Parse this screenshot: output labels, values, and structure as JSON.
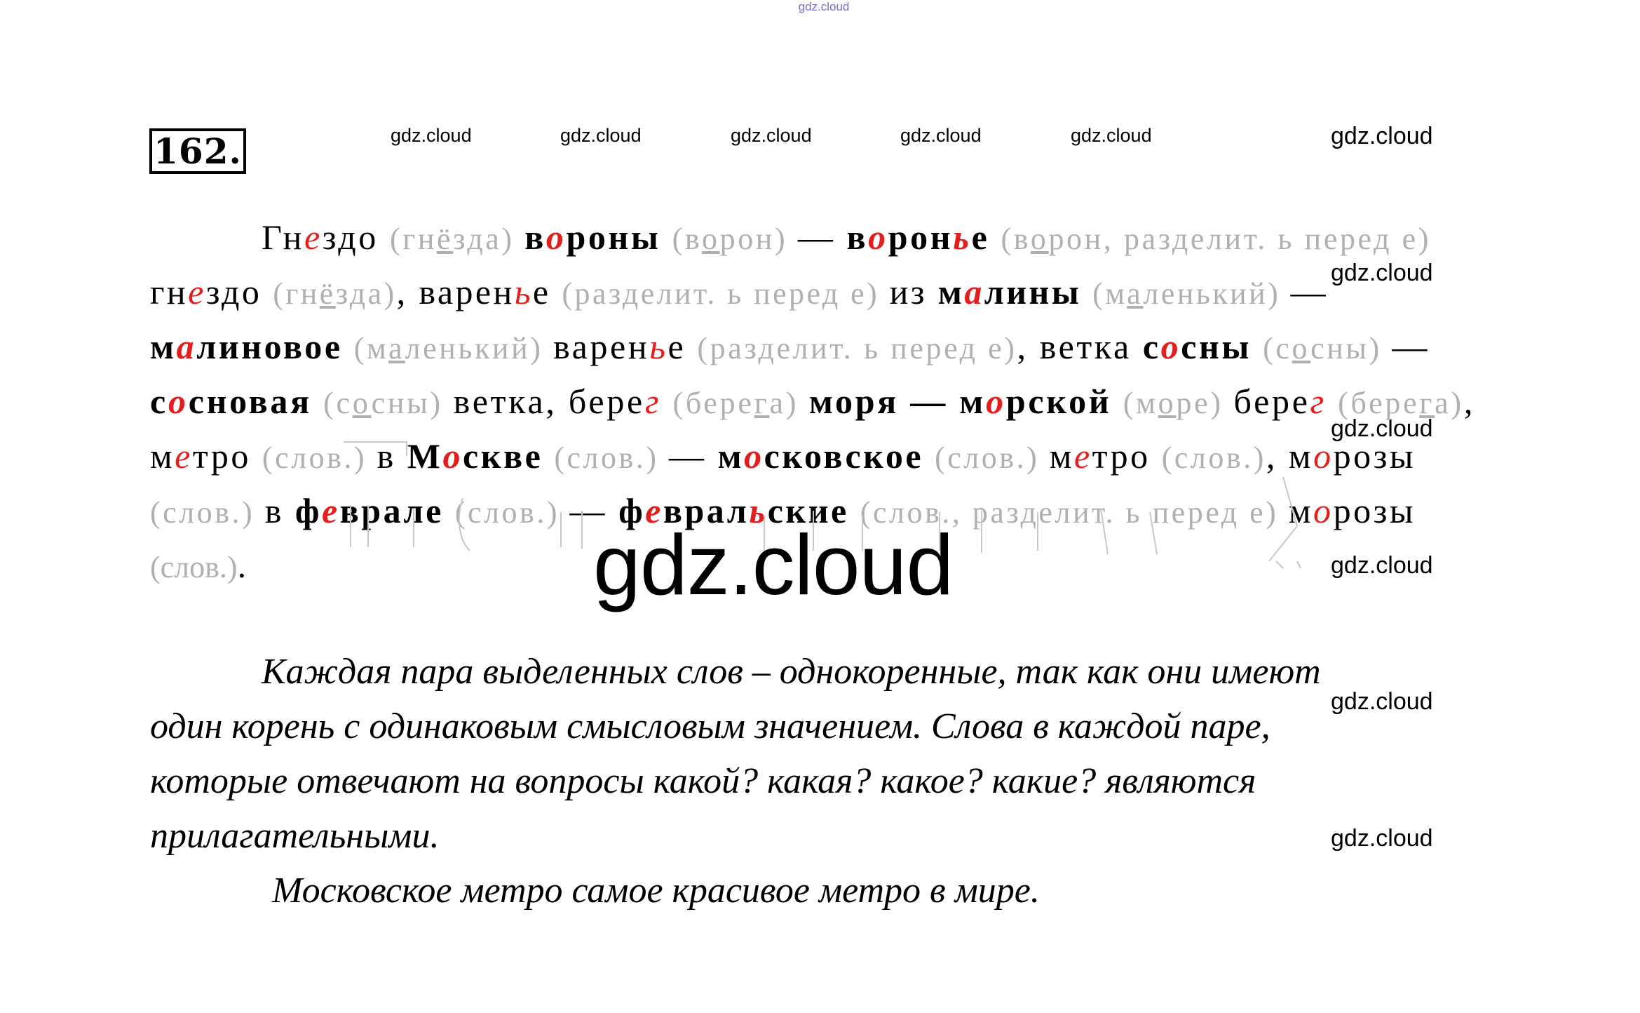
{
  "header_mark": "gdz.cloud",
  "exercise_number": "162.",
  "watermark": "gdz.cloud",
  "lines": [
    [
      {
        "t": "Гн"
      },
      {
        "t": "е",
        "c": "r"
      },
      {
        "t": "здо "
      },
      {
        "t": "(гн",
        "c": "g"
      },
      {
        "t": "ё",
        "c": "g u"
      },
      {
        "t": "зда) ",
        "c": "g"
      },
      {
        "t": "в",
        "c": "b"
      },
      {
        "t": "о",
        "c": "b r"
      },
      {
        "t": "роны ",
        "c": "b"
      },
      {
        "t": "(в",
        "c": "g"
      },
      {
        "t": "о",
        "c": "g u"
      },
      {
        "t": "рон) ",
        "c": "g"
      },
      {
        "t": "— "
      },
      {
        "t": "в",
        "c": "b"
      },
      {
        "t": "о",
        "c": "b r"
      },
      {
        "t": "рон",
        "c": "b"
      },
      {
        "t": "ь",
        "c": "b r"
      },
      {
        "t": "е ",
        "c": "b"
      },
      {
        "t": "(в",
        "c": "g"
      },
      {
        "t": "о",
        "c": "g u"
      },
      {
        "t": "рон, разделит. ь перед е)",
        "c": "g"
      }
    ],
    [
      {
        "t": "гн"
      },
      {
        "t": "е",
        "c": "r"
      },
      {
        "t": "здо "
      },
      {
        "t": "(гн",
        "c": "g"
      },
      {
        "t": "ё",
        "c": "g u"
      },
      {
        "t": "зда)",
        "c": "g"
      },
      {
        "t": ", варен"
      },
      {
        "t": "ь",
        "c": "r"
      },
      {
        "t": "е "
      },
      {
        "t": "(разделит. ь перед е) ",
        "c": "g"
      },
      {
        "t": "из "
      },
      {
        "t": "м",
        "c": "b"
      },
      {
        "t": "а",
        "c": "b r"
      },
      {
        "t": "лины ",
        "c": "b"
      },
      {
        "t": "(м",
        "c": "g"
      },
      {
        "t": "а",
        "c": "g u"
      },
      {
        "t": "ленький) ",
        "c": "g"
      },
      {
        "t": "—"
      }
    ],
    [
      {
        "t": "м",
        "c": "b"
      },
      {
        "t": "а",
        "c": "b r"
      },
      {
        "t": "линовое ",
        "c": "b"
      },
      {
        "t": "(м",
        "c": "g"
      },
      {
        "t": "а",
        "c": "g u"
      },
      {
        "t": "ленький) ",
        "c": "g"
      },
      {
        "t": "варен"
      },
      {
        "t": "ь",
        "c": "r"
      },
      {
        "t": "е "
      },
      {
        "t": "(разделит. ь перед е)",
        "c": "g"
      },
      {
        "t": ", ветка "
      },
      {
        "t": "с",
        "c": "b"
      },
      {
        "t": "о",
        "c": "b r"
      },
      {
        "t": "сны ",
        "c": "b"
      },
      {
        "t": "(с",
        "c": "g"
      },
      {
        "t": "о",
        "c": "g u"
      },
      {
        "t": "сны) ",
        "c": "g"
      },
      {
        "t": "—"
      }
    ],
    [
      {
        "t": "с",
        "c": "b"
      },
      {
        "t": "о",
        "c": "b r"
      },
      {
        "t": "сновая ",
        "c": "b"
      },
      {
        "t": "(с",
        "c": "g"
      },
      {
        "t": "о",
        "c": "g u"
      },
      {
        "t": "сны) ",
        "c": "g"
      },
      {
        "t": "ветка, бере"
      },
      {
        "t": "г",
        "c": "r"
      },
      {
        "t": " "
      },
      {
        "t": "(бере",
        "c": "g"
      },
      {
        "t": "г",
        "c": "g u"
      },
      {
        "t": "а) ",
        "c": "g"
      },
      {
        "t": "моря — ",
        "c": "b"
      },
      {
        "t": "м",
        "c": "b"
      },
      {
        "t": "о",
        "c": "b r"
      },
      {
        "t": "рской ",
        "c": "b"
      },
      {
        "t": "(м",
        "c": "g"
      },
      {
        "t": "о",
        "c": "g u"
      },
      {
        "t": "ре) ",
        "c": "g"
      },
      {
        "t": "бере"
      },
      {
        "t": "г",
        "c": "r"
      },
      {
        "t": " "
      },
      {
        "t": "(бере",
        "c": "g"
      },
      {
        "t": "г",
        "c": "g u"
      },
      {
        "t": "а)",
        "c": "g"
      },
      {
        "t": ","
      }
    ],
    [
      {
        "t": "м"
      },
      {
        "t": "е",
        "c": "r"
      },
      {
        "t": "тро "
      },
      {
        "t": "(слов.) ",
        "c": "g"
      },
      {
        "t": "в "
      },
      {
        "t": "М",
        "c": "b"
      },
      {
        "t": "о",
        "c": "b r"
      },
      {
        "t": "скве ",
        "c": "b"
      },
      {
        "t": "(слов.) ",
        "c": "g"
      },
      {
        "t": "— "
      },
      {
        "t": "м",
        "c": "b"
      },
      {
        "t": "о",
        "c": "b r"
      },
      {
        "t": "сковское ",
        "c": "b"
      },
      {
        "t": "(слов.) ",
        "c": "g"
      },
      {
        "t": "м"
      },
      {
        "t": "е",
        "c": "r"
      },
      {
        "t": "тро "
      },
      {
        "t": "(слов.)",
        "c": "g"
      },
      {
        "t": ", м"
      },
      {
        "t": "о",
        "c": "r"
      },
      {
        "t": "розы"
      }
    ],
    [
      {
        "t": "(слов.) ",
        "c": "g"
      },
      {
        "t": "в "
      },
      {
        "t": "ф",
        "c": "b"
      },
      {
        "t": "е",
        "c": "b r"
      },
      {
        "t": "врале ",
        "c": "b"
      },
      {
        "t": "(слов.) ",
        "c": "g"
      },
      {
        "t": "— "
      },
      {
        "t": "ф",
        "c": "b"
      },
      {
        "t": "е",
        "c": "b r"
      },
      {
        "t": "врал",
        "c": "b"
      },
      {
        "t": "ь",
        "c": "b r"
      },
      {
        "t": "ские ",
        "c": "b"
      },
      {
        "t": "(слов., разделит. ь перед е) ",
        "c": "g"
      },
      {
        "t": "м"
      },
      {
        "t": "о",
        "c": "r"
      },
      {
        "t": "розы"
      }
    ],
    [
      {
        "t": "(слов.)",
        "c": "g"
      },
      {
        "t": "."
      }
    ]
  ],
  "explanation": [
    "Каждая пара выделенных слов – однокоренные, так как они имеют",
    "один корень с одинаковым смысловым значением. Слова в каждой паре,",
    "которые отвечают на вопросы какой? какая? какое? какие? являются",
    "прилагательными."
  ],
  "sentence": "Московское метро самое красивое метро в мире."
}
